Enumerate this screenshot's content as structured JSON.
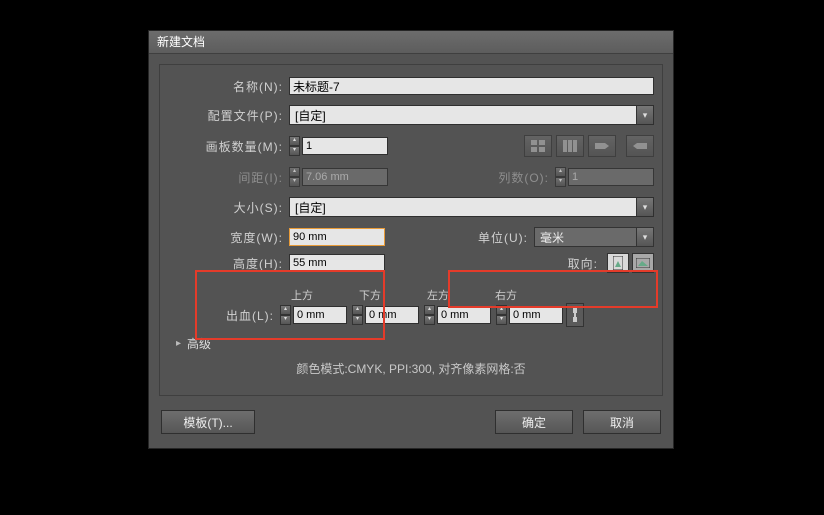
{
  "title": "新建文档",
  "name": {
    "label": "名称(N):",
    "value": "未标题-7"
  },
  "profile": {
    "label": "配置文件(P):",
    "value": "[自定]"
  },
  "artboards": {
    "label": "画板数量(M):",
    "value": "1"
  },
  "spacing": {
    "label": "间距(I):",
    "value": "7.06 mm"
  },
  "columns": {
    "label": "列数(O):",
    "value": "1"
  },
  "size": {
    "label": "大小(S):",
    "value": "[自定]"
  },
  "width": {
    "label": "宽度(W):",
    "value": "90 mm"
  },
  "height": {
    "label": "高度(H):",
    "value": "55 mm"
  },
  "units": {
    "label": "单位(U):",
    "value": "毫米"
  },
  "orientation": {
    "label": "取向:"
  },
  "bleed": {
    "label": "出血(L):",
    "headers": {
      "top": "上方",
      "bottom": "下方",
      "left": "左方",
      "right": "右方"
    },
    "values": {
      "top": "0 mm",
      "bottom": "0 mm",
      "left": "0 mm",
      "right": "0 mm"
    }
  },
  "advanced": "高级",
  "summary": "颜色模式:CMYK, PPI:300, 对齐像素网格:否",
  "buttons": {
    "template": "模板(T)...",
    "ok": "确定",
    "cancel": "取消"
  }
}
